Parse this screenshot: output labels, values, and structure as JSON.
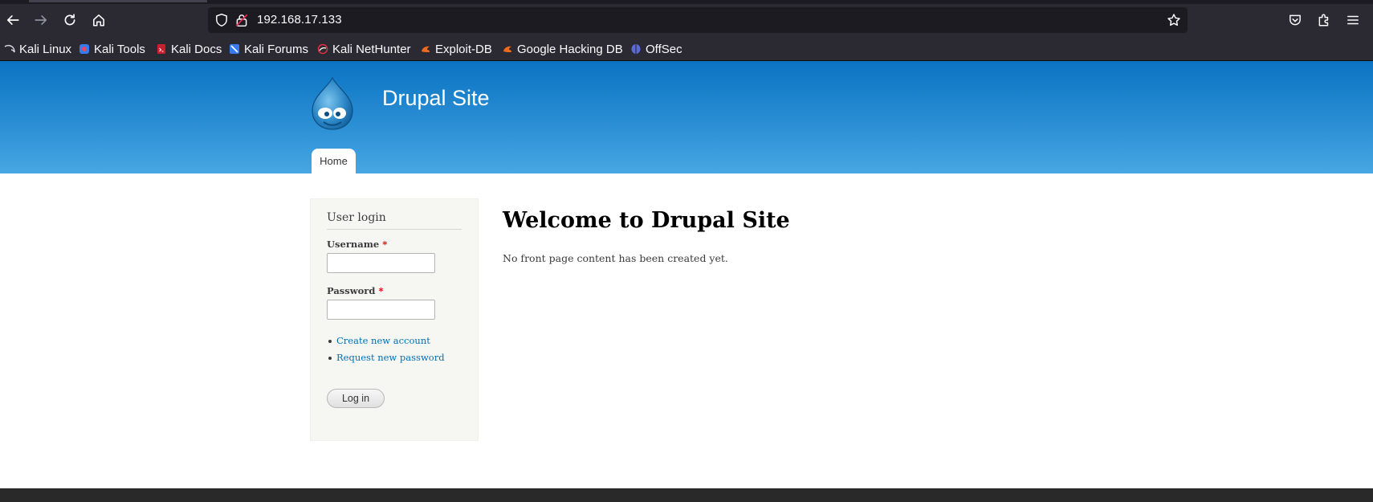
{
  "browser": {
    "url": "192.168.17.133",
    "bookmarks": [
      {
        "label": "Kali Linux",
        "icon": "kali-dragon-icon"
      },
      {
        "label": "Kali Tools",
        "icon": "kali-tools-icon"
      },
      {
        "label": "Kali Docs",
        "icon": "kali-docs-icon"
      },
      {
        "label": "Kali Forums",
        "icon": "kali-forums-icon"
      },
      {
        "label": "Kali NetHunter",
        "icon": "nethunter-icon"
      },
      {
        "label": "Exploit-DB",
        "icon": "exploit-db-icon"
      },
      {
        "label": "Google Hacking DB",
        "icon": "ghdb-icon"
      },
      {
        "label": "OffSec",
        "icon": "offsec-icon"
      }
    ]
  },
  "site": {
    "name": "Drupal Site",
    "nav_home": "Home"
  },
  "sidebar": {
    "block_title": "User login",
    "username_label": "Username",
    "password_label": "Password",
    "required_mark": "*",
    "links": [
      "Create new account",
      "Request new password"
    ],
    "login_button": "Log in"
  },
  "main": {
    "title": "Welcome to Drupal Site",
    "body": "No front page content has been created yet."
  },
  "colors": {
    "header_top": "#0a73c2",
    "header_bottom": "#47a7e3",
    "link": "#0071b3",
    "required": "#e00000"
  }
}
